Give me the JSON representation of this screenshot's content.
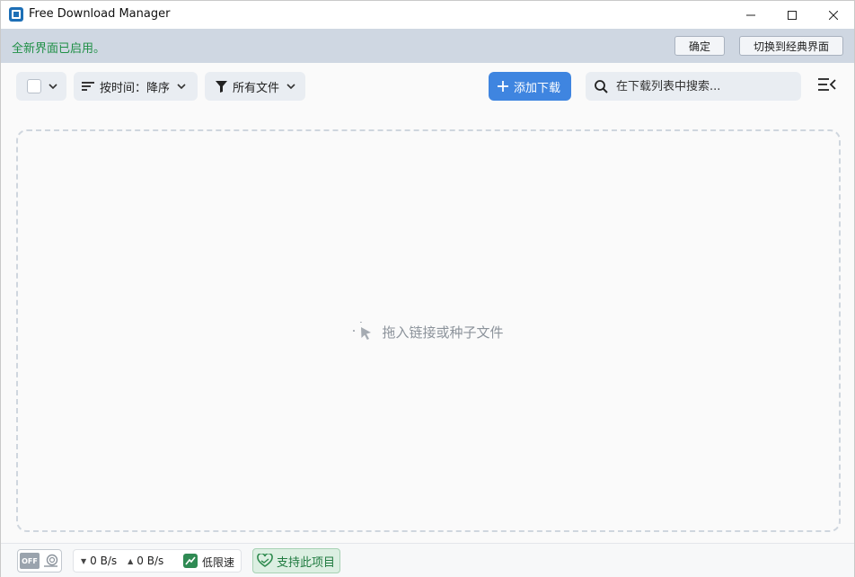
{
  "window": {
    "title": "Free Download Manager"
  },
  "notification": {
    "message": "全新界面已启用。",
    "ok_label": "确定",
    "classic_label": "切换到经典界面"
  },
  "toolbar": {
    "sort_label": "按时间：降序",
    "filter_label": "所有文件",
    "add_label": "添加下载",
    "search_placeholder": "在下载列表中搜索..."
  },
  "drop_area": {
    "hint": "拖入链接或种子文件"
  },
  "statusbar": {
    "toggle_label": "OFF",
    "download_speed": "0 B/s",
    "upload_speed": "0 B/s",
    "low_speed_label": "低限速",
    "support_label": "支持此项目"
  },
  "colors": {
    "accent": "#3f85e0",
    "notify_bg": "#cfd7e2",
    "notify_text": "#1f8f46",
    "support_bg": "#dcefe2"
  },
  "icons": {
    "app": "fdm-app-icon",
    "sort": "sort-lines-icon",
    "filter": "funnel-icon",
    "add": "plus-icon",
    "search": "search-icon",
    "menu": "menu-collapse-icon",
    "drop": "cursor-click-icon",
    "snail": "snail-icon",
    "low_speed": "chart-up-icon",
    "support": "heart-hands-icon"
  }
}
